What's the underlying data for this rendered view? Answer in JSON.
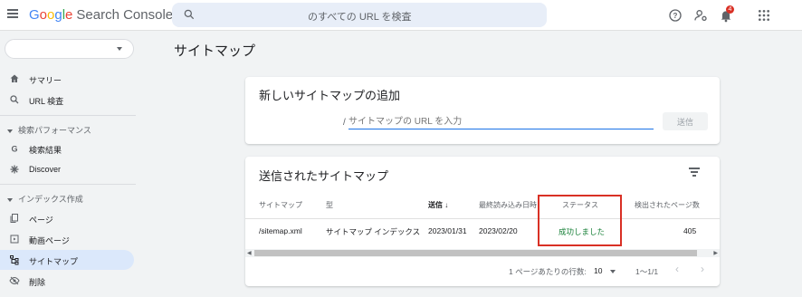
{
  "app": {
    "logo_google": "Google",
    "logo_product": "Search Console"
  },
  "search": {
    "placeholder": "のすべての URL を検査"
  },
  "notifications": {
    "count": "4"
  },
  "sidebar": {
    "items": [
      {
        "label": "サマリー",
        "icon": "home-icon"
      },
      {
        "label": "URL 検査",
        "icon": "search-icon"
      }
    ],
    "sections": [
      {
        "label": "検索パフォーマンス",
        "items": [
          {
            "label": "検索結果",
            "icon": "google-g-icon"
          },
          {
            "label": "Discover",
            "icon": "asterisk-icon"
          }
        ]
      },
      {
        "label": "インデックス作成",
        "items": [
          {
            "label": "ページ",
            "icon": "pages-icon"
          },
          {
            "label": "動画ページ",
            "icon": "video-page-icon"
          },
          {
            "label": "サイトマップ",
            "icon": "sitemap-icon",
            "active": true
          },
          {
            "label": "削除",
            "icon": "eye-off-icon"
          }
        ]
      }
    ]
  },
  "page": {
    "title": "サイトマップ"
  },
  "add_card": {
    "title": "新しいサイトマップの追加",
    "slash": "/",
    "placeholder": "サイトマップの URL を入力",
    "submit_label": "送信"
  },
  "submitted_card": {
    "title": "送信されたサイトマップ",
    "columns": {
      "sitemap": "サイトマップ",
      "type": "型",
      "submitted": "送信",
      "last_read": "最終読み込み日時",
      "status": "ステータス",
      "discovered": "検出されたページ数"
    },
    "rows": [
      {
        "sitemap": "/sitemap.xml",
        "type": "サイトマップ インデックス",
        "submitted": "2023/01/31",
        "last_read": "2023/02/20",
        "status": "成功しました",
        "discovered": "405"
      }
    ],
    "pagination": {
      "rows_per_page_label": "1 ページあたりの行数:",
      "rows_per_page": "10",
      "range": "1〜1/1"
    }
  },
  "colors": {
    "accent": "#1a73e8",
    "success": "#188038",
    "highlight": "#d93025"
  }
}
